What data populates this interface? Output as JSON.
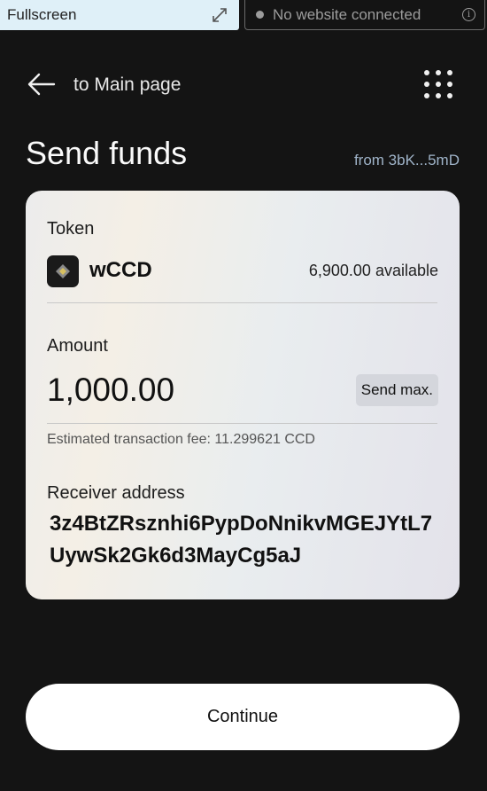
{
  "topbar": {
    "fullscreen_label": "Fullscreen",
    "connection_status": "No website connected",
    "info_glyph": "i"
  },
  "nav": {
    "back_label": "to Main page"
  },
  "page": {
    "title": "Send funds",
    "from": "from 3bK...5mD"
  },
  "token": {
    "label": "Token",
    "name": "wCCD",
    "available": "6,900.00 available"
  },
  "amount": {
    "label": "Amount",
    "value": "1,000.00",
    "send_max_label": "Send max.",
    "fee": "Estimated transaction fee: 11.299621 CCD"
  },
  "receiver": {
    "label": "Receiver address",
    "address": "3z4BtZRsznhi6PypDoNnikvMGEJYtL7UywSk2Gk6d3MayCg5aJ"
  },
  "actions": {
    "continue_label": "Continue"
  },
  "colors": {
    "background": "#141414",
    "accent_from": "#9fb3c8"
  }
}
